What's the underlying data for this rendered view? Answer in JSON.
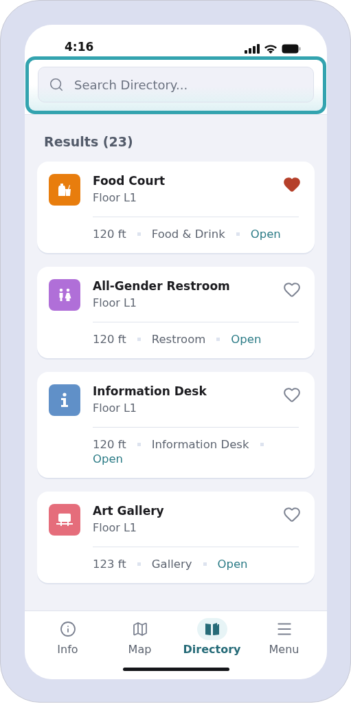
{
  "status_bar": {
    "time": "4:16"
  },
  "search": {
    "placeholder": "Search Directory...",
    "focused": true
  },
  "results_heading": "Results (23)",
  "results": [
    {
      "name": "Food Court",
      "floor": "Floor L1",
      "distance": "120 ft",
      "category": "Food & Drink",
      "status": "Open",
      "favorite": true,
      "kind": "food",
      "color": "#e87d0d"
    },
    {
      "name": "All-Gender Restroom",
      "floor": "Floor L1",
      "distance": "120 ft",
      "category": "Restroom",
      "status": "Open",
      "favorite": false,
      "kind": "restroom",
      "color": "#b06fd8"
    },
    {
      "name": "Information Desk",
      "floor": "Floor L1",
      "distance": "120 ft",
      "category": "Information Desk",
      "status": "Open",
      "favorite": false,
      "kind": "info",
      "color": "#6090c8"
    },
    {
      "name": "Art Gallery",
      "floor": "Floor L1",
      "distance": "123 ft",
      "category": "Gallery",
      "status": "Open",
      "favorite": false,
      "kind": "gallery",
      "color": "#e56d7b"
    }
  ],
  "tabs": [
    {
      "label": "Info",
      "kind": "info",
      "selected": false
    },
    {
      "label": "Map",
      "kind": "map",
      "selected": false
    },
    {
      "label": "Directory",
      "kind": "directory",
      "selected": true
    },
    {
      "label": "Menu",
      "kind": "menu",
      "selected": false
    }
  ]
}
